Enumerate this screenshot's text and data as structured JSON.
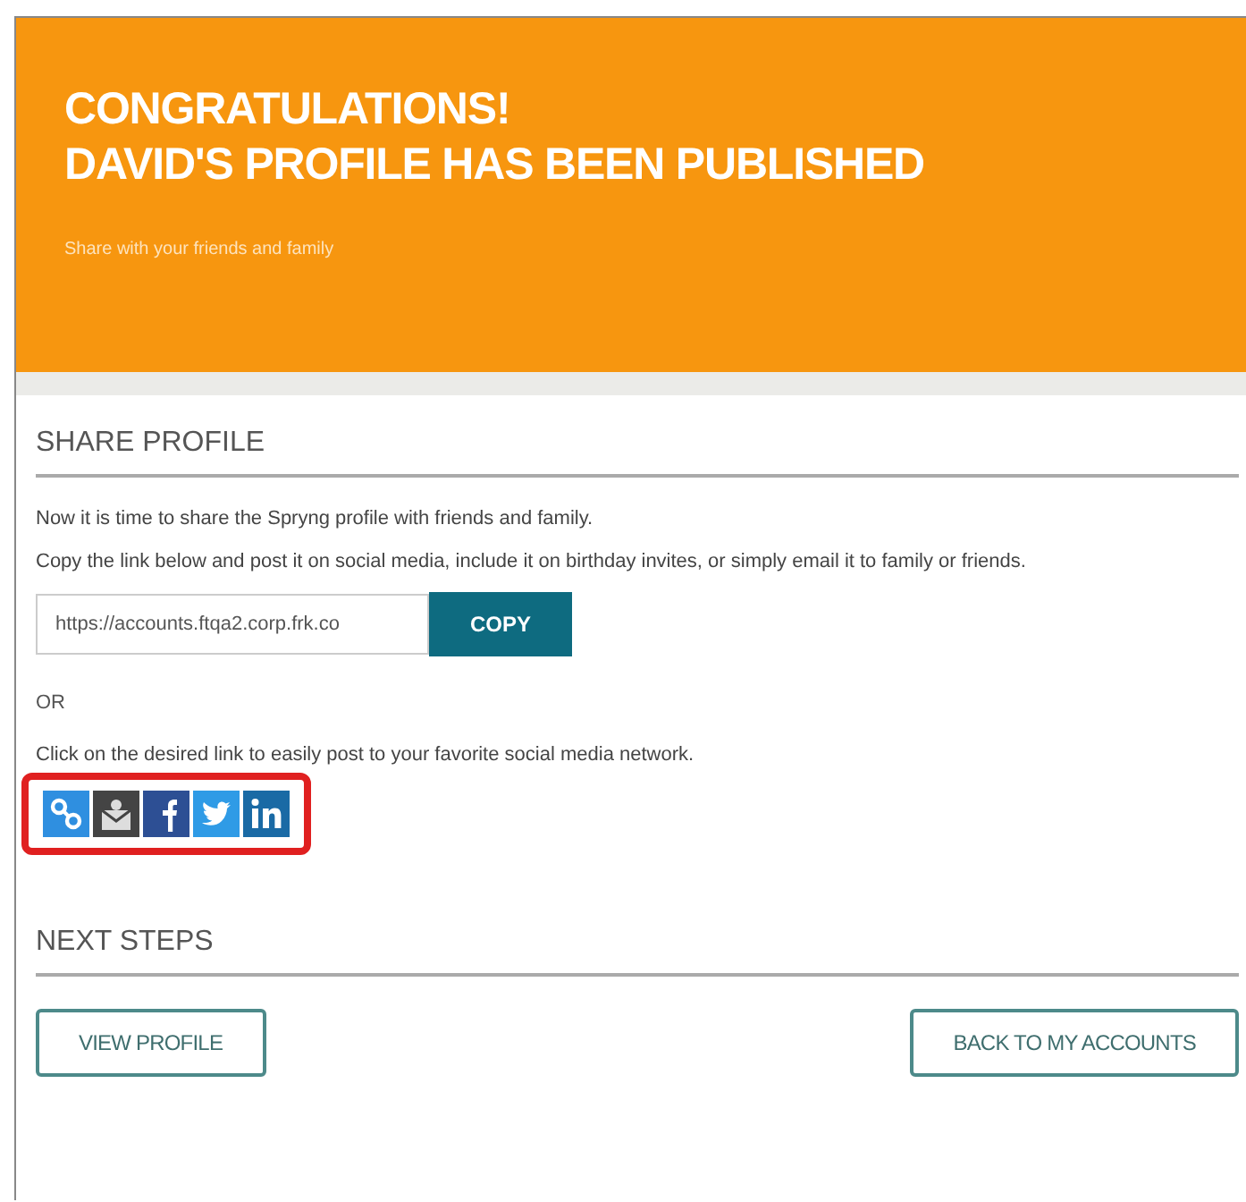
{
  "header": {
    "title_lines": [
      "CONGRATULATIONS!",
      "DAVID'S PROFILE HAS BEEN PUBLISHED"
    ],
    "subtitle": "Share with your friends and family"
  },
  "share_profile": {
    "heading": "SHARE PROFILE",
    "paragraphs": [
      "Now it is time to share the Spryng profile with friends and family.",
      "Copy the link below and post it on social media, include it on birthday invites, or simply email it to family or friends."
    ],
    "link_field": {
      "value": "https://accounts.ftqa2.corp.frk.co"
    },
    "copy_button": "COPY",
    "or_text": "OR",
    "social_prompt": "Click on the desired link to easily post to your favorite social media network.",
    "social_links": [
      {
        "kind": "link"
      },
      {
        "kind": "email"
      },
      {
        "kind": "facebook"
      },
      {
        "kind": "twitter"
      },
      {
        "kind": "linkedin"
      }
    ],
    "highlighted": true
  },
  "next_steps": {
    "heading": "NEXT STEPS",
    "buttons": [
      "VIEW PROFILE",
      "BACK TO MY ACCOUNTS"
    ]
  }
}
